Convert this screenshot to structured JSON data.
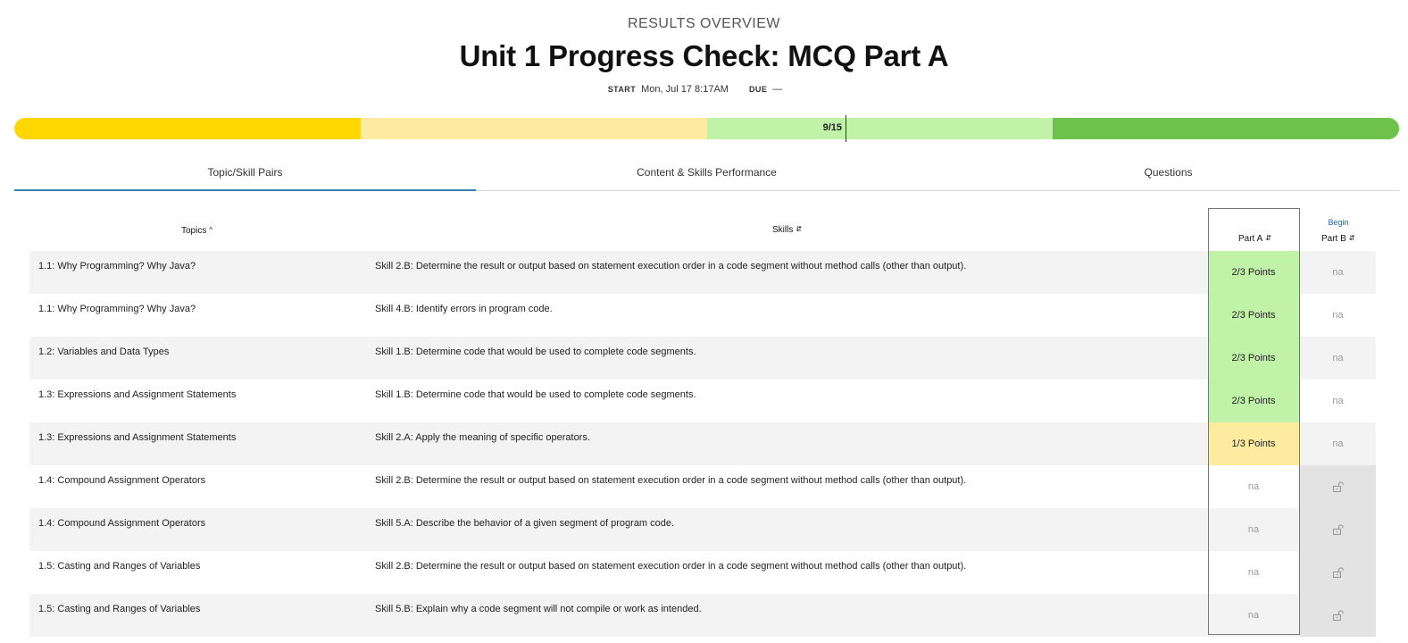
{
  "header": {
    "eyebrow": "RESULTS OVERVIEW",
    "title": "Unit 1 Progress Check: MCQ Part A",
    "start_label": "START",
    "start_value": "Mon, Jul 17 8:17AM",
    "due_label": "DUE",
    "due_value": "—"
  },
  "progress": {
    "score_label": "9/15",
    "score_fraction": 0.6,
    "segments": [
      {
        "color": "#FFD700"
      },
      {
        "color": "#FDEBA0"
      },
      {
        "color": "#C0F2A8"
      },
      {
        "color": "#6CC24A"
      }
    ]
  },
  "tabs": [
    {
      "label": "Topic/Skill Pairs",
      "active": true
    },
    {
      "label": "Content & Skills Performance",
      "active": false
    },
    {
      "label": "Questions",
      "active": false
    }
  ],
  "table": {
    "headers": {
      "topics": "Topics",
      "skills": "Skills",
      "part_a": "Part A",
      "part_b": "Part B",
      "begin": "Begin"
    },
    "rows": [
      {
        "topic": "1.1: Why Programming? Why Java?",
        "skill": "Skill 2.B: Determine the result or output based on statement execution order in a code segment without method calls (other than output).",
        "part_a": "2/3 Points",
        "part_a_color": "#C0F2A8",
        "part_b": "na",
        "part_b_locked": false
      },
      {
        "topic": "1.1: Why Programming? Why Java?",
        "skill": "Skill 4.B: Identify errors in program code.",
        "part_a": "2/3 Points",
        "part_a_color": "#C0F2A8",
        "part_b": "na",
        "part_b_locked": false
      },
      {
        "topic": "1.2: Variables and Data Types",
        "skill": "Skill 1.B: Determine code that would be used to complete code segments.",
        "part_a": "2/3 Points",
        "part_a_color": "#C0F2A8",
        "part_b": "na",
        "part_b_locked": false
      },
      {
        "topic": "1.3: Expressions and Assignment Statements",
        "skill": "Skill 1.B: Determine code that would be used to complete code segments.",
        "part_a": "2/3 Points",
        "part_a_color": "#C0F2A8",
        "part_b": "na",
        "part_b_locked": false
      },
      {
        "topic": "1.3: Expressions and Assignment Statements",
        "skill": "Skill 2.A: Apply the meaning of specific operators.",
        "part_a": "1/3 Points",
        "part_a_color": "#FDEBA0",
        "part_b": "na",
        "part_b_locked": false
      },
      {
        "topic": "1.4: Compound Assignment Operators",
        "skill": "Skill 2.B: Determine the result or output based on statement execution order in a code segment without method calls (other than output).",
        "part_a": "na",
        "part_a_color": "",
        "part_b": "",
        "part_b_locked": true
      },
      {
        "topic": "1.4: Compound Assignment Operators",
        "skill": "Skill 5.A: Describe the behavior of a given segment of program code.",
        "part_a": "na",
        "part_a_color": "",
        "part_b": "",
        "part_b_locked": true
      },
      {
        "topic": "1.5: Casting and Ranges of Variables",
        "skill": "Skill 2.B: Determine the result or output based on statement execution order in a code segment without method calls (other than output).",
        "part_a": "na",
        "part_a_color": "",
        "part_b": "",
        "part_b_locked": true
      },
      {
        "topic": "1.5: Casting and Ranges of Variables",
        "skill": "Skill 5.B: Explain why a code segment will not compile or work as intended.",
        "part_a": "na",
        "part_a_color": "",
        "part_b": "",
        "part_b_locked": true
      }
    ]
  },
  "icons": {
    "sort_asc": "sort-ascending-icon",
    "sort_both": "sort-icon",
    "lock": "unlock-icon"
  }
}
